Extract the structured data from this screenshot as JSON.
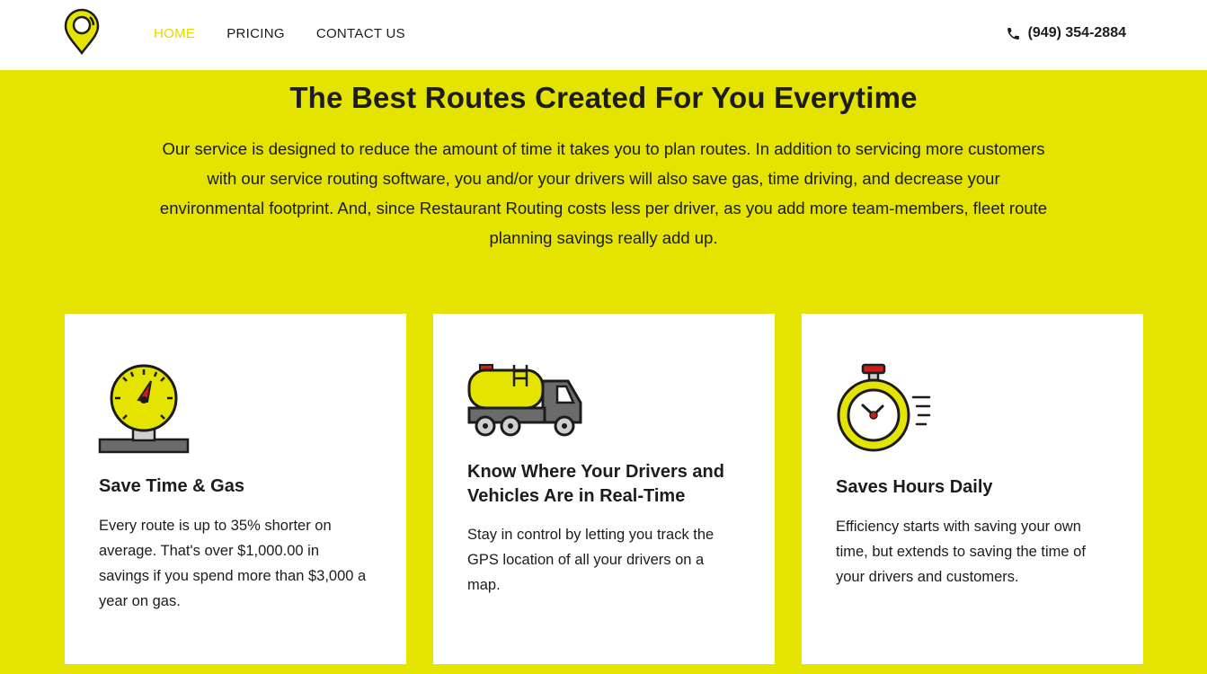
{
  "nav": {
    "home": "HOME",
    "pricing": "PRICING",
    "contact": "CONTACT US"
  },
  "phone": "(949) 354-2884",
  "hero": {
    "title": "The Best Routes Created For You Everytime",
    "text": "Our service is designed to reduce the amount of time it takes you to plan routes. In addition to servicing more customers with our service routing software, you and/or your drivers will also save gas, time driving, and decrease your environmental footprint. And, since Restaurant Routing costs less per driver, as you add more team-members, fleet route planning savings really add up."
  },
  "cards": [
    {
      "icon": "gas-gauge-icon",
      "title": "Save Time & Gas",
      "text": "Every route is up to 35% shorter on average. That's over $1,000.00 in savings if you spend more than $3,000 a year on gas."
    },
    {
      "icon": "tanker-truck-icon",
      "title": "Know Where Your Drivers and Vehicles Are in Real-Time",
      "text": "Stay in control by letting you track the GPS location of all your drivers on a map."
    },
    {
      "icon": "stopwatch-icon",
      "title": "Saves Hours Daily",
      "text": "Efficiency starts with saving your own time, but extends to saving the time of your drivers and customers."
    }
  ],
  "colors": {
    "accent": "#e5e300",
    "active_nav": "#e5d900",
    "text": "#1c1c1c",
    "card_bg": "#ffffff"
  }
}
